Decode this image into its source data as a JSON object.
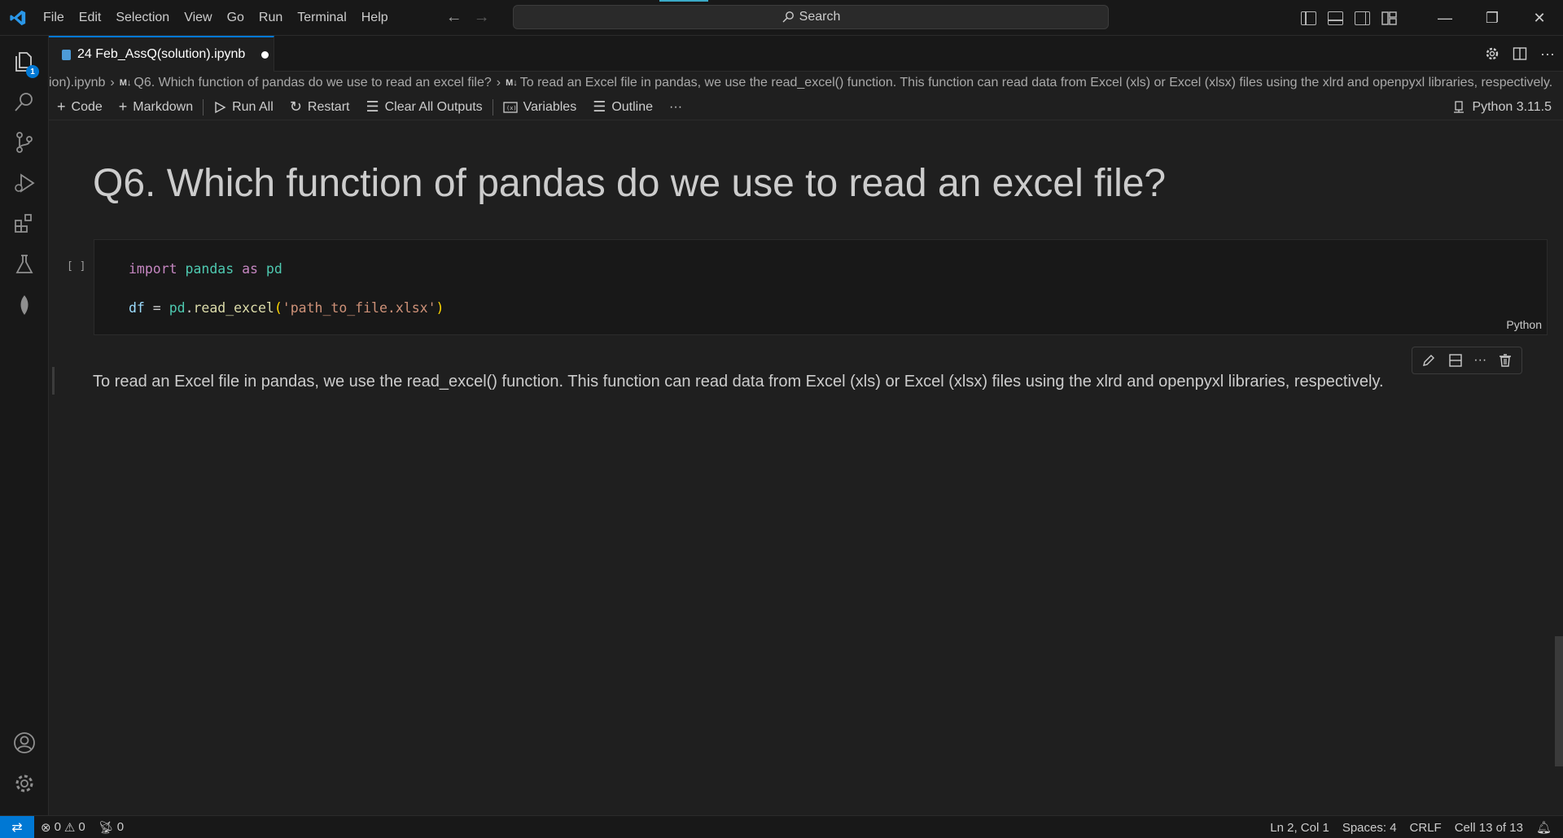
{
  "menu": [
    "File",
    "Edit",
    "Selection",
    "View",
    "Go",
    "Run",
    "Terminal",
    "Help"
  ],
  "search": {
    "label": "Search"
  },
  "activity": {
    "explorer_badge": "1"
  },
  "tab": {
    "title": "24 Feb_AssQ(solution).ipynb"
  },
  "breadcrumb": {
    "file": "ion).ipynb",
    "md_marker": "M↓",
    "cell1": "Q6. Which function of pandas do we use to read an excel file?",
    "cell2": "To read an Excel file in pandas, we use the read_excel() function. This function can read data from Excel (xls) or Excel (xlsx) files using the xlrd and openpyxl libraries, respectively."
  },
  "toolbar": {
    "code": "Code",
    "markdown": "Markdown",
    "run_all": "Run All",
    "restart": "Restart",
    "clear_outputs": "Clear All Outputs",
    "variables": "Variables",
    "outline": "Outline",
    "more": "···",
    "kernel": "Python 3.11.5"
  },
  "notebook": {
    "heading": "Q6. Which function of pandas do we use to read an excel file?",
    "code_cell": {
      "exec_count": "[ ]",
      "language": "Python",
      "line1": {
        "kw": "import",
        "mod": "pandas",
        "as": "as",
        "alias": "pd"
      },
      "line2": {
        "var": "df",
        "eq": " = ",
        "mod": "pd",
        "dot": ".",
        "fn": "read_excel",
        "open": "(",
        "str": "'path_to_file.xlsx'",
        "close": ")"
      }
    },
    "markdown_text": "To read an Excel file in pandas, we use the read_excel() function. This function can read data from Excel (xls) or Excel (xlsx) files using the xlrd and openpyxl libraries, respectively."
  },
  "status": {
    "errors": "0",
    "warnings": "0",
    "ports": "0",
    "position": "Ln 2, Col 1",
    "spaces": "Spaces: 4",
    "eol": "CRLF",
    "cell": "Cell 13 of 13"
  }
}
